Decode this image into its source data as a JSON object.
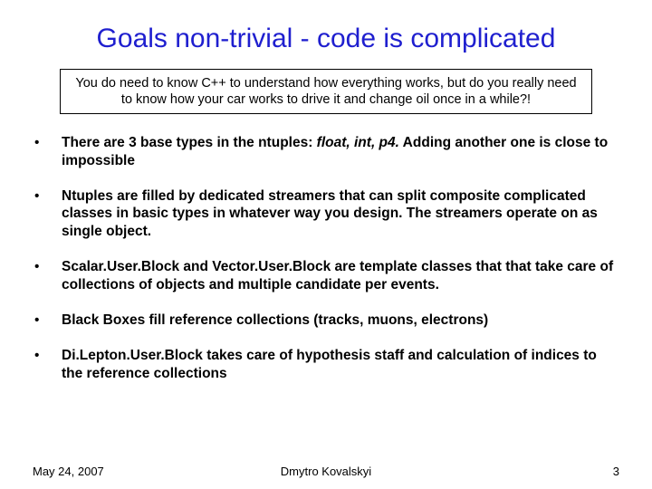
{
  "title": "Goals non-trivial - code is complicated",
  "callout": "You do need to know C++ to understand how everything works, but do you really need to know how your car works to drive it and change oil once in a while?!",
  "bullets": [
    {
      "pre": "There are 3 base types in the ntuples: ",
      "ital": "float, int, p4.",
      "post": " Adding another one is close to impossible"
    },
    {
      "pre": "Ntuples are filled by dedicated streamers that can split composite complicated classes in basic types in whatever way you design. The streamers operate on as single object.",
      "ital": "",
      "post": ""
    },
    {
      "pre": "Scalar.User.Block and Vector.User.Block are template classes that that take care of collections of objects and multiple candidate per events.",
      "ital": "",
      "post": ""
    },
    {
      "pre": "Black Boxes fill reference collections (tracks, muons, electrons)",
      "ital": "",
      "post": ""
    },
    {
      "pre": "Di.Lepton.User.Block takes care of hypothesis staff and calculation of indices to the reference collections",
      "ital": "",
      "post": ""
    }
  ],
  "footer": {
    "date": "May 24, 2007",
    "author": "Dmytro Kovalskyi",
    "page": "3"
  }
}
